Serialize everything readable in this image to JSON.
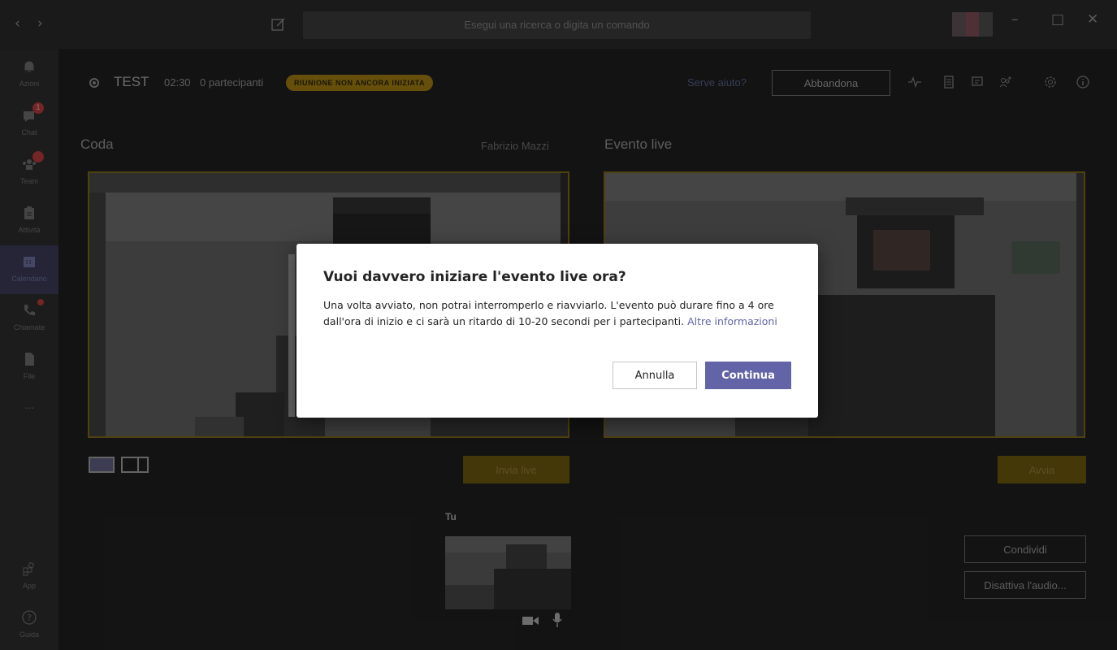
{
  "titlebar": {
    "back_icon": "chevron-left-icon",
    "forward_icon": "chevron-right-icon",
    "compose_icon": "compose-icon",
    "search_placeholder": "Esegui una ricerca o digita un comando",
    "window_controls": [
      "minimize-icon",
      "maximize-icon",
      "close-icon"
    ]
  },
  "rail": {
    "items": [
      {
        "label": "Azioni",
        "icon": "bell-icon"
      },
      {
        "label": "Chat",
        "icon": "chat-icon",
        "badge": "1"
      },
      {
        "label": "Team",
        "icon": "teams-icon",
        "badge": ""
      },
      {
        "label": "Attività",
        "icon": "assignments-icon"
      },
      {
        "label": "Calendario",
        "icon": "calendar-icon",
        "active": true
      },
      {
        "label": "Chiamate",
        "icon": "phone-icon"
      },
      {
        "label": "File",
        "icon": "file-icon"
      },
      {
        "label": "...",
        "icon": "more-icon"
      }
    ],
    "bottom": [
      {
        "label": "App",
        "icon": "apps-icon"
      },
      {
        "label": "Guida",
        "icon": "help-icon"
      }
    ]
  },
  "meeting": {
    "title": "TEST",
    "time": "02:30",
    "participants": "0 partecipanti",
    "status": "RIUNIONE NON ANCORA INIZIATA",
    "help": "Serve aiuto?",
    "leave": "Abbandona",
    "toolbar_icons": [
      "health-icon",
      "notes-icon",
      "chat-icon",
      "participants-add-icon",
      "settings-icon",
      "info-icon"
    ]
  },
  "queue": {
    "title": "Coda",
    "presenter": "Fabrizio Mazzi",
    "send_live": "Invia live"
  },
  "live": {
    "title": "Evento live",
    "start": "Avvia"
  },
  "self": {
    "label": "Tu"
  },
  "side_actions": {
    "share": "Condividi",
    "mute": "Disattiva l'audio..."
  },
  "dialog": {
    "title": "Vuoi davvero iniziare l'evento live ora?",
    "body": "Una volta avviato, non potrai interromperlo e riavviarlo. L'evento può durare fino a 4 ore dall'ora di inizio e ci sarà un ritardo di 10-20 secondi per i partecipanti. ",
    "link": "Altre informazioni",
    "cancel": "Annulla",
    "continue": "Continua"
  },
  "colors": {
    "accent": "#6264a7",
    "gold": "#9b7a12",
    "badge": "#b33a3a"
  }
}
